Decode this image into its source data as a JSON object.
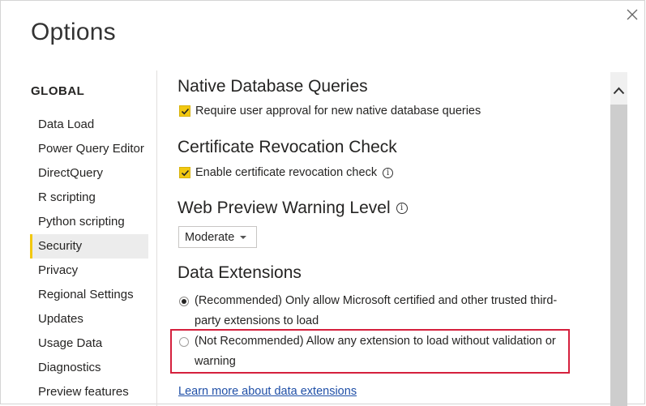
{
  "window": {
    "title": "Options",
    "close_icon": "close-icon"
  },
  "sidebar": {
    "group_title": "GLOBAL",
    "items": [
      {
        "label": "Data Load"
      },
      {
        "label": "Power Query Editor"
      },
      {
        "label": "DirectQuery"
      },
      {
        "label": "R scripting"
      },
      {
        "label": "Python scripting"
      },
      {
        "label": "Security",
        "selected": true
      },
      {
        "label": "Privacy"
      },
      {
        "label": "Regional Settings"
      },
      {
        "label": "Updates"
      },
      {
        "label": "Usage Data"
      },
      {
        "label": "Diagnostics"
      },
      {
        "label": "Preview features"
      }
    ]
  },
  "main": {
    "native_queries": {
      "heading": "Native Database Queries",
      "checkbox_label": "Require user approval for new native database queries",
      "checked": true
    },
    "cert_revocation": {
      "heading": "Certificate Revocation Check",
      "checkbox_label": "Enable certificate revocation check",
      "checked": true
    },
    "web_preview": {
      "heading": "Web Preview Warning Level",
      "selected_value": "Moderate"
    },
    "data_extensions": {
      "heading": "Data Extensions",
      "options": [
        {
          "label": "(Recommended) Only allow Microsoft certified and other trusted third-party extensions to load",
          "checked": true
        },
        {
          "label": "(Not Recommended) Allow any extension to load without validation or warning",
          "checked": false
        }
      ],
      "learn_more": "Learn more about data extensions"
    }
  },
  "colors": {
    "accent": "#f2c811",
    "highlight_border": "#d5203d",
    "link": "#1f4fa7"
  }
}
